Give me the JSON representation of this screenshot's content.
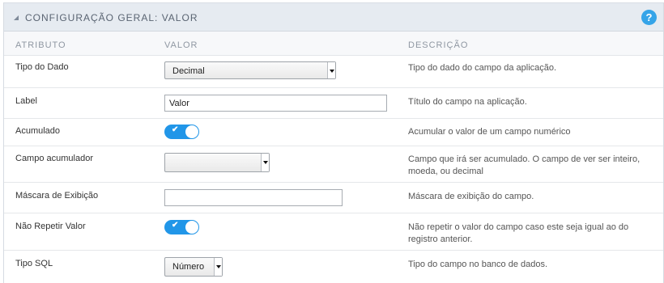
{
  "header": {
    "title": "CONFIGURAÇÃO GERAL: VALOR",
    "help_icon": "?"
  },
  "columns": {
    "attribute": "ATRIBUTO",
    "value": "VALOR",
    "description": "DESCRIÇÃO"
  },
  "rows": {
    "tipo_dado": {
      "label": "Tipo do Dado",
      "value": "Decimal",
      "description": "Tipo do dado do campo da aplicação."
    },
    "label": {
      "label": "Label",
      "value": "Valor",
      "description": "Título do campo na aplicação."
    },
    "acumulado": {
      "label": "Acumulado",
      "toggle_on": true,
      "check": "✔",
      "description": "Acumular o valor de um campo numérico"
    },
    "campo_acum": {
      "label": "Campo acumulador",
      "value": "",
      "description": "Campo que irá ser acumulado. O campo de ver ser inteiro, moeda, ou decimal"
    },
    "mascara": {
      "label": "Máscara de Exibição",
      "value": "",
      "description": "Máscara de exibição do campo."
    },
    "nao_repetir": {
      "label": "Não Repetir Valor",
      "toggle_on": true,
      "check": "✔",
      "description": "Não repetir o valor do campo caso este seja igual ao do registro anterior."
    },
    "tipo_sql": {
      "label": "Tipo SQL",
      "value": "Número",
      "description": "Tipo do campo no banco de dados."
    }
  }
}
